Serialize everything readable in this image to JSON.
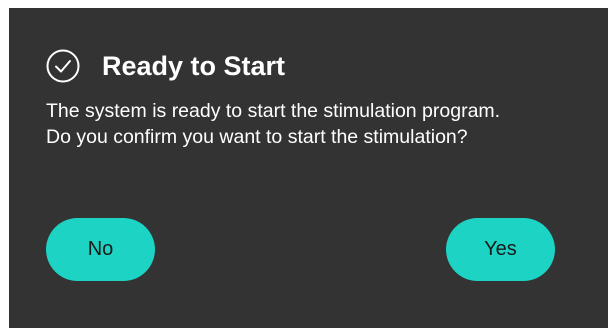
{
  "dialog": {
    "icon": "circle-check-icon",
    "title": "Ready to Start",
    "message_lines": [
      "The system is ready to start the stimulation program.",
      "Do you confirm you want to start the stimulation?"
    ],
    "no_label": "No",
    "yes_label": "Yes"
  },
  "colors": {
    "dialog_background": "#333333",
    "text": "#ffffff",
    "button_background": "#1dd3c3",
    "button_text": "#1a1a1a"
  }
}
